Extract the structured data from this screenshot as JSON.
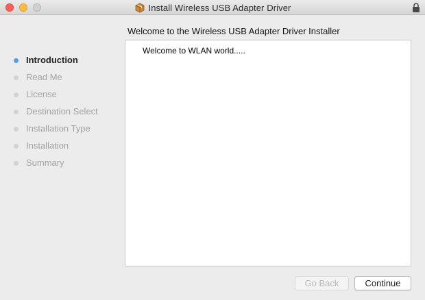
{
  "window": {
    "title": "Install Wireless USB Adapter Driver",
    "title_icon": "package-icon",
    "lock_icon": "lock-icon"
  },
  "heading": "Welcome to the Wireless USB Adapter Driver Installer",
  "steps": [
    {
      "label": "Introduction",
      "state": "current"
    },
    {
      "label": "Read Me",
      "state": "pending"
    },
    {
      "label": "License",
      "state": "pending"
    },
    {
      "label": "Destination Select",
      "state": "pending"
    },
    {
      "label": "Installation Type",
      "state": "pending"
    },
    {
      "label": "Installation",
      "state": "pending"
    },
    {
      "label": "Summary",
      "state": "pending"
    }
  ],
  "content": {
    "text": "Welcome to WLAN world....."
  },
  "buttons": {
    "back_label": "Go Back",
    "back_enabled": false,
    "continue_label": "Continue",
    "continue_enabled": true
  },
  "colors": {
    "active_step_dot": "#5a9be6",
    "inactive_step_dot": "#d3d3d3",
    "close": "#fc605b",
    "minimize": "#fdbc40"
  }
}
